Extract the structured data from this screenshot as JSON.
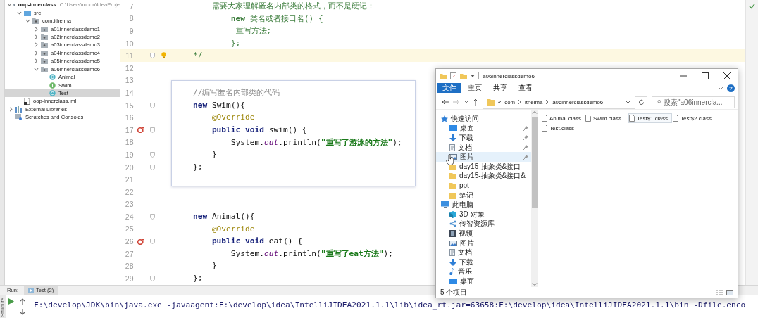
{
  "project": {
    "tree": [
      {
        "label": "oop-innerclass",
        "path": "C:\\Users\\moon\\IdeaProje",
        "kind": "module",
        "expanded": true,
        "selected": false,
        "children": [
          {
            "label": "src",
            "kind": "source",
            "expanded": true,
            "selected": false,
            "children": [
              {
                "label": "com.itheima",
                "kind": "package",
                "expanded": true,
                "selected": false,
                "children": [
                  {
                    "label": "a01innerclassdemo1",
                    "kind": "package",
                    "expanded": false,
                    "selected": false
                  },
                  {
                    "label": "a02innerclassdemo2",
                    "kind": "package",
                    "expanded": false,
                    "selected": false
                  },
                  {
                    "label": "a03innerclassdemo3",
                    "kind": "package",
                    "expanded": false,
                    "selected": false
                  },
                  {
                    "label": "a04innerclassdemo4",
                    "kind": "package",
                    "expanded": false,
                    "selected": false
                  },
                  {
                    "label": "a05innerclassdemo5",
                    "kind": "package",
                    "expanded": false,
                    "selected": false
                  },
                  {
                    "label": "a06innerclassdemo6",
                    "kind": "package",
                    "expanded": true,
                    "selected": false,
                    "children": [
                      {
                        "label": "Animal",
                        "kind": "class",
                        "selected": false
                      },
                      {
                        "label": "Swim",
                        "kind": "interface",
                        "selected": false
                      },
                      {
                        "label": "Test",
                        "kind": "class",
                        "selected": true
                      }
                    ]
                  }
                ]
              }
            ]
          },
          {
            "label": "oop-innerclass.iml",
            "kind": "iml",
            "selected": false
          }
        ]
      },
      {
        "label": "External Libraries",
        "kind": "libraries",
        "expanded": false,
        "selected": false
      },
      {
        "label": "Scratches and Consoles",
        "kind": "scratches",
        "selected": false
      }
    ]
  },
  "editor": {
    "lines": [
      {
        "number": "7",
        "fold": false,
        "tokens": [
          {
            "text": "        需要大家理解匿名内部类的格式，而不是硬记：",
            "kind": "doc"
          }
        ]
      },
      {
        "number": "8",
        "fold": false,
        "tokens": [
          {
            "text": "            new",
            "kind": "docb"
          },
          {
            "text": " 类名或者接口名() {",
            "kind": "doc"
          }
        ]
      },
      {
        "number": "9",
        "fold": false,
        "tokens": [
          {
            "text": "             重写方法;",
            "kind": "doc"
          }
        ]
      },
      {
        "number": "10",
        "fold": false,
        "tokens": [
          {
            "text": "            };",
            "kind": "doc"
          }
        ]
      },
      {
        "number": "11",
        "fold": true,
        "current": true,
        "bulb": true,
        "tokens": [
          {
            "text": "    */",
            "kind": "doc"
          }
        ]
      },
      {
        "number": "12",
        "fold": false
      },
      {
        "number": "13",
        "fold": false
      },
      {
        "number": "14",
        "fold": false,
        "framed": true,
        "tokens": [
          {
            "text": "    //编写匿名内部类的代码",
            "kind": "comment"
          }
        ]
      },
      {
        "number": "15",
        "fold": true,
        "framed": true,
        "tokens": [
          {
            "text": "    new",
            "kind": "kw"
          },
          {
            "text": " Swim(){",
            "kind": "plain"
          }
        ]
      },
      {
        "number": "16",
        "fold": false,
        "framed": true,
        "tokens": [
          {
            "text": "        @Override",
            "kind": "ann"
          }
        ]
      },
      {
        "number": "17",
        "fold": true,
        "framed": true,
        "override": true,
        "tokens": [
          {
            "text": "        public void",
            "kind": "kw"
          },
          {
            "text": " swim() {",
            "kind": "plain"
          }
        ]
      },
      {
        "number": "18",
        "fold": false,
        "framed": true,
        "tokens": [
          {
            "text": "            System.",
            "kind": "plain"
          },
          {
            "text": "out",
            "kind": "static"
          },
          {
            "text": ".println(",
            "kind": "plain"
          },
          {
            "text": "\"重写了游泳的方法\"",
            "kind": "str"
          },
          {
            "text": ");",
            "kind": "plain"
          }
        ]
      },
      {
        "number": "19",
        "fold": true,
        "framed": true,
        "tokens": [
          {
            "text": "        }",
            "kind": "plain"
          }
        ]
      },
      {
        "number": "20",
        "fold": true,
        "framed": true,
        "tokens": [
          {
            "text": "    };",
            "kind": "plain"
          }
        ]
      },
      {
        "number": "21",
        "fold": false,
        "framed": true
      },
      {
        "number": "22",
        "fold": false
      },
      {
        "number": "23",
        "fold": false
      },
      {
        "number": "24",
        "fold": true,
        "tokens": [
          {
            "text": "    new",
            "kind": "kw"
          },
          {
            "text": " Animal(){",
            "kind": "plain"
          }
        ]
      },
      {
        "number": "25",
        "fold": false,
        "tokens": [
          {
            "text": "        @Override",
            "kind": "ann"
          }
        ]
      },
      {
        "number": "26",
        "fold": true,
        "override": true,
        "tokens": [
          {
            "text": "        public void",
            "kind": "kw"
          },
          {
            "text": " eat() {",
            "kind": "plain"
          }
        ]
      },
      {
        "number": "27",
        "fold": false,
        "tokens": [
          {
            "text": "            System.",
            "kind": "plain"
          },
          {
            "text": "out",
            "kind": "static"
          },
          {
            "text": ".println(",
            "kind": "plain"
          },
          {
            "text": "\"重写了eat方法\"",
            "kind": "str"
          },
          {
            "text": ");",
            "kind": "plain"
          }
        ]
      },
      {
        "number": "28",
        "fold": false,
        "tokens": [
          {
            "text": "        }",
            "kind": "plain"
          }
        ]
      },
      {
        "number": "29",
        "fold": true,
        "tokens": [
          {
            "text": "    };",
            "kind": "plain"
          }
        ]
      }
    ]
  },
  "run": {
    "label": "Run:",
    "tab": "Test (2)",
    "side_tab": "Structure",
    "console": "F:\\develop\\JDK\\bin\\java.exe -javaagent:F:\\develop\\idea\\IntelliJIDEA2021.1.1\\lib\\idea_rt.jar=63658:F:\\develop\\idea\\IntelliJIDEA2021.1.1\\bin -Dfile.enco"
  },
  "explorer": {
    "title": "a06innerclassdemo6",
    "ribbon_tabs": [
      {
        "label": "文件",
        "selected": true
      },
      {
        "label": "主页",
        "selected": false
      },
      {
        "label": "共享",
        "selected": false
      },
      {
        "label": "查看",
        "selected": false
      }
    ],
    "help": "?",
    "address": {
      "overflow": "«",
      "crumbs": [
        "com",
        "itheima",
        "a06innerclassdemo6"
      ]
    },
    "search": {
      "placeholder": "搜索\"a06innercla..."
    },
    "nav": [
      {
        "label": "快速访问",
        "kind": "quick",
        "pinned": false,
        "highlighted": false,
        "children": [
          {
            "label": "桌面",
            "kind": "desktop",
            "pinned": true,
            "highlighted": false
          },
          {
            "label": "下载",
            "kind": "downloads",
            "pinned": true,
            "highlighted": false
          },
          {
            "label": "文档",
            "kind": "documents",
            "pinned": true,
            "highlighted": false
          },
          {
            "label": "图片",
            "kind": "pictures",
            "pinned": true,
            "highlighted": true
          },
          {
            "label": "day15-抽象类&接口",
            "kind": "folder",
            "pinned": false,
            "highlighted": false
          },
          {
            "label": "day15-抽象类&接口&",
            "kind": "folder",
            "pinned": false,
            "highlighted": false
          },
          {
            "label": "ppt",
            "kind": "folder",
            "pinned": false,
            "highlighted": false
          },
          {
            "label": "笔记",
            "kind": "folder",
            "pinned": false,
            "highlighted": false
          }
        ]
      },
      {
        "label": "此电脑",
        "kind": "pc",
        "pinned": false,
        "highlighted": false,
        "children": [
          {
            "label": "3D 对象",
            "kind": "objects3d",
            "pinned": false,
            "highlighted": false
          },
          {
            "label": "传智资源库",
            "kind": "library",
            "pinned": false,
            "highlighted": false
          },
          {
            "label": "视频",
            "kind": "videos",
            "pinned": false,
            "highlighted": false
          },
          {
            "label": "图片",
            "kind": "pictures",
            "pinned": false,
            "highlighted": false
          },
          {
            "label": "文档",
            "kind": "documents",
            "pinned": false,
            "highlighted": false
          },
          {
            "label": "下载",
            "kind": "downloads",
            "pinned": false,
            "highlighted": false
          },
          {
            "label": "音乐",
            "kind": "music",
            "pinned": false,
            "highlighted": false
          },
          {
            "label": "桌面",
            "kind": "desktop",
            "pinned": false,
            "highlighted": false
          }
        ]
      }
    ],
    "files": [
      {
        "name": "Animal.class",
        "selected": false
      },
      {
        "name": "Swim.class",
        "selected": false
      },
      {
        "name": "Test$1.class",
        "selected": true
      },
      {
        "name": "Test$2.class",
        "selected": false
      },
      {
        "name": "Test.class",
        "selected": false
      }
    ],
    "status": "5 个项目"
  }
}
